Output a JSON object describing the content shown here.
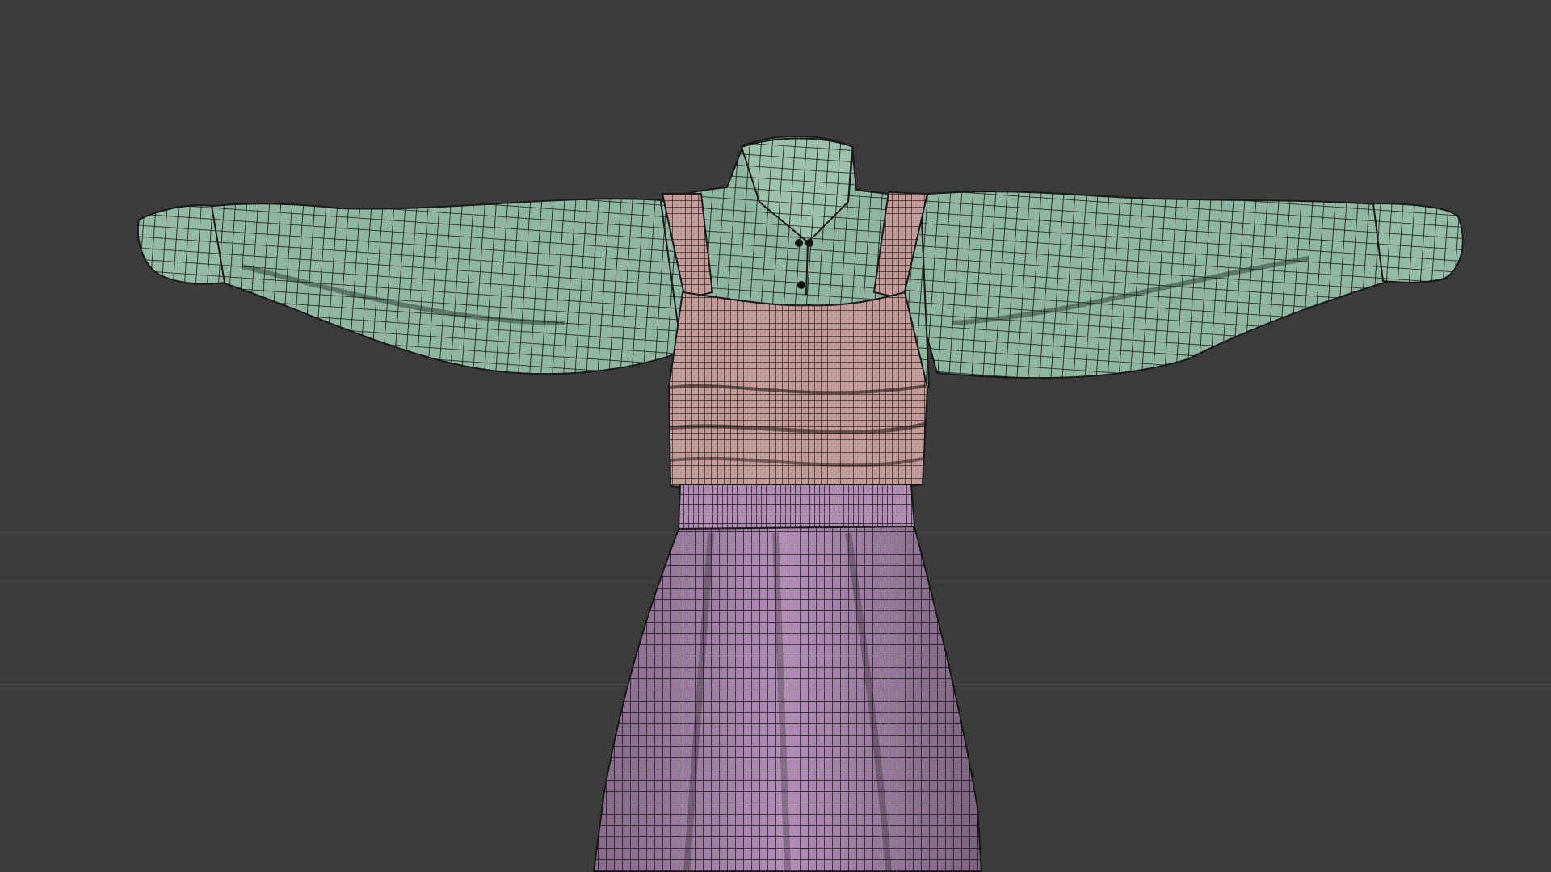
{
  "viewport": {
    "background": "#3c3c3c",
    "grid_line_color": "#474747",
    "wire_color": "#141414"
  },
  "garments": {
    "shirt": {
      "name": "shirt",
      "color": "#8fb6a0",
      "icon": "mesh-shirt"
    },
    "top": {
      "name": "smocked-top",
      "color": "#c49a98",
      "icon": "mesh-top"
    },
    "skirt": {
      "name": "skirt",
      "color": "#b18db6",
      "icon": "mesh-skirt"
    },
    "buttons": {
      "name": "shirt-buttons",
      "color": "#111111",
      "count": 3
    }
  }
}
